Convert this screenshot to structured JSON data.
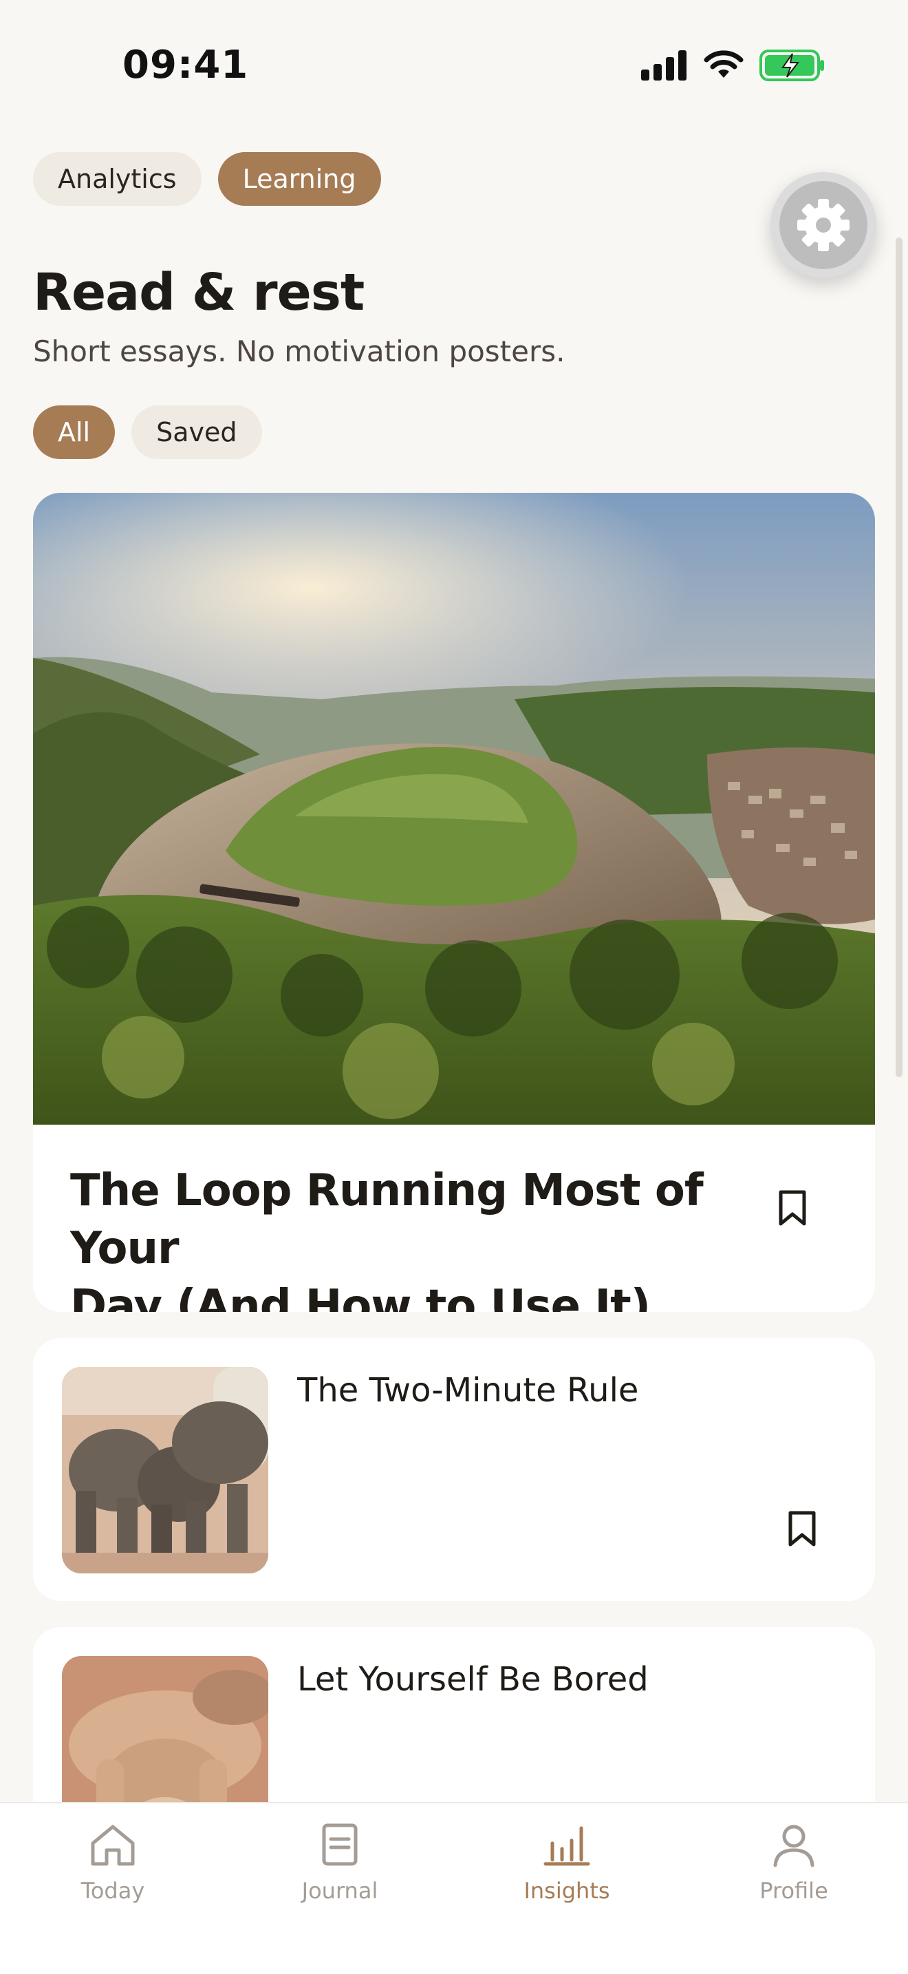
{
  "status_bar": {
    "time": "09:41"
  },
  "segments": [
    {
      "label": "Analytics",
      "active": false
    },
    {
      "label": "Learning",
      "active": true
    }
  ],
  "settings": {
    "icon": "gear-icon"
  },
  "header": {
    "title": "Read & rest",
    "subtitle": "Short essays. No motivation posters."
  },
  "filters": [
    {
      "label": "All",
      "active": true
    },
    {
      "label": "Saved",
      "active": false
    }
  ],
  "featured": {
    "title_line1": "The Loop Running Most of Your",
    "title_line2": "Day (And How to Use It)",
    "image": "river-bend-landscape",
    "saved": false
  },
  "articles": [
    {
      "title": "The Two-Minute Rule",
      "image": "elephants-photo",
      "saved": false
    },
    {
      "title": "Let Yourself Be Bored",
      "image": "resting-camel-photo",
      "saved": false
    }
  ],
  "nav": [
    {
      "label": "Today",
      "icon": "home-icon",
      "active": false
    },
    {
      "label": "Journal",
      "icon": "journal-icon",
      "active": false
    },
    {
      "label": "Insights",
      "icon": "bar-chart-icon",
      "active": true
    },
    {
      "label": "Profile",
      "icon": "person-icon",
      "active": false
    }
  ],
  "colors": {
    "accent": "#a67c55",
    "background": "#f9f7f4",
    "chip": "#efeae2",
    "nav_inactive": "#a49c95"
  }
}
